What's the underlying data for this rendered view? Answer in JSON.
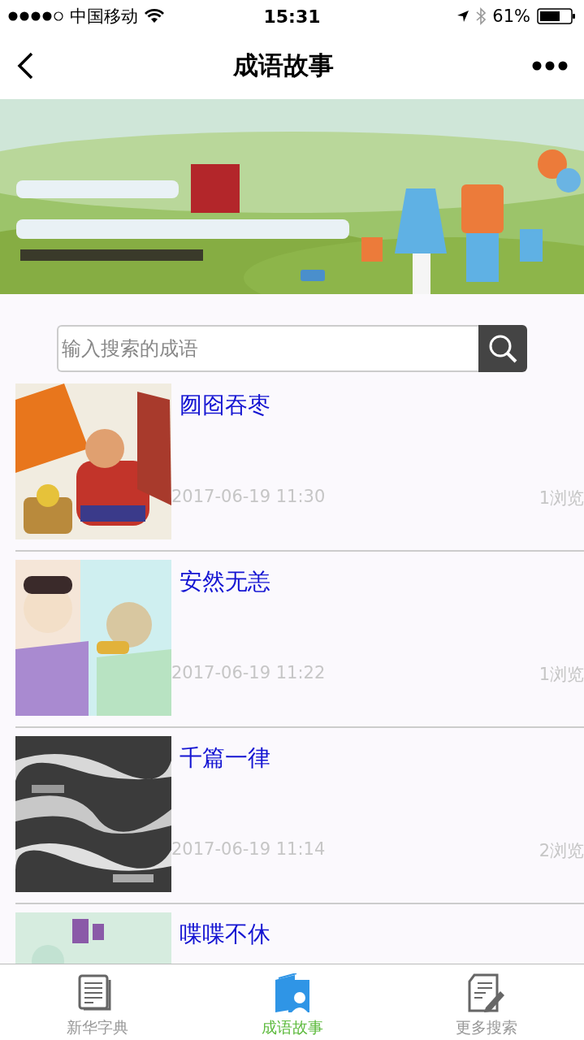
{
  "status_bar": {
    "carrier": "中国移动",
    "time": "15:31",
    "battery": "61%"
  },
  "nav": {
    "title": "成语故事"
  },
  "search": {
    "placeholder": "输入搜索的成语"
  },
  "stories": [
    {
      "title": "囫囵吞枣",
      "date": "2017-06-19 11:30",
      "views": "1浏览"
    },
    {
      "title": "安然无恙",
      "date": "2017-06-19 11:22",
      "views": "1浏览"
    },
    {
      "title": "千篇一律",
      "date": "2017-06-19 11:14",
      "views": "2浏览"
    },
    {
      "title": "喋喋不休"
    }
  ],
  "tabs": [
    {
      "label": "新华字典",
      "selected": false
    },
    {
      "label": "成语故事",
      "selected": true
    },
    {
      "label": "更多搜索",
      "selected": false
    }
  ]
}
